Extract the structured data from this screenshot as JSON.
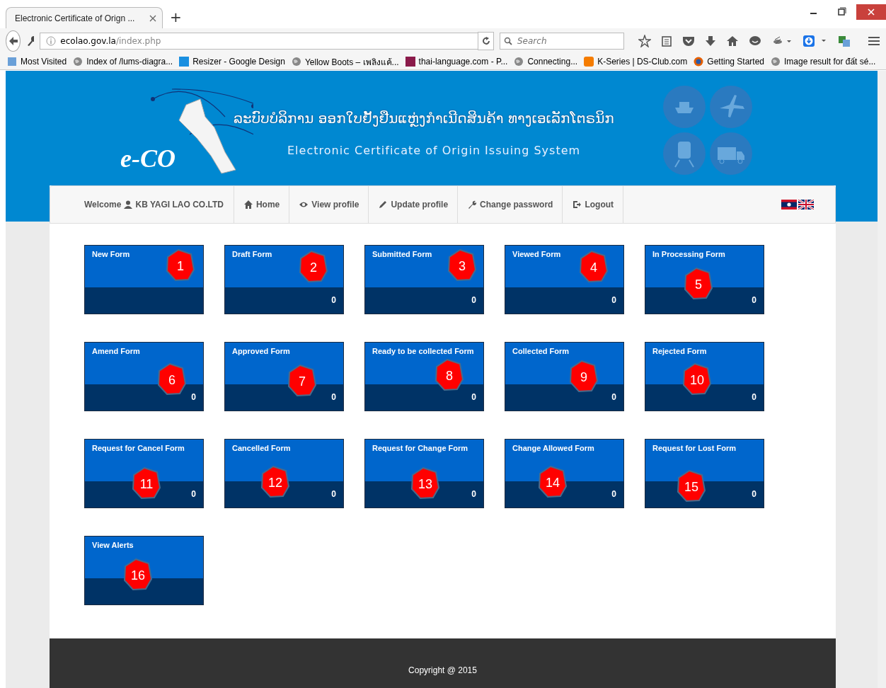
{
  "browser": {
    "tab_title": "Electronic Certificate of Orign ...",
    "new_tab": "+",
    "url_domain": "ecolao.gov.la",
    "url_path": "/index.php",
    "search_placeholder": "Search",
    "bookmarks": [
      "Most Visited",
      "Index of /lums-diagra...",
      "Resizer - Google Design",
      "Yellow Boots – เพลิงแค้...",
      "thai-language.com - P...",
      "Connecting...",
      "K-Series | DS-Club.com",
      "Getting Started",
      "Image result for đất sé..."
    ]
  },
  "header": {
    "logo": "e-CO",
    "title_lao": "ລະບົບບໍລິການ ອອກໃບຢັ້ງຢືນແຫຼ່ງກຳເນີດສິນຄ້າ ທາງເອເລັກໂຕຣນິກ",
    "title_en": "Electronic Certificate of Origin Issuing System"
  },
  "nav": {
    "welcome": "Welcome",
    "user": "KB YAGI LAO CO.LTD",
    "items": [
      {
        "label": "Home"
      },
      {
        "label": "View profile"
      },
      {
        "label": "Update profile"
      },
      {
        "label": "Change password"
      },
      {
        "label": "Logout"
      }
    ]
  },
  "tiles": [
    {
      "title": "New Form",
      "marker": "1"
    },
    {
      "title": "Draft Form",
      "count": "0",
      "marker": "2"
    },
    {
      "title": "Submitted Form",
      "count": "0",
      "marker": "3"
    },
    {
      "title": "Viewed Form",
      "count": "0",
      "marker": "4"
    },
    {
      "title": "In Processing Form",
      "count": "0",
      "marker": "5"
    },
    {
      "title": "Amend Form",
      "count": "0",
      "marker": "6"
    },
    {
      "title": "Approved Form",
      "count": "0",
      "marker": "7"
    },
    {
      "title": "Ready to be collected Form",
      "count": "0",
      "marker": "8"
    },
    {
      "title": "Collected Form",
      "count": "0",
      "marker": "9"
    },
    {
      "title": "Rejected Form",
      "count": "0",
      "marker": "10"
    },
    {
      "title": "Request for Cancel Form",
      "count": "0",
      "marker": "11"
    },
    {
      "title": "Cancelled Form",
      "count": "0",
      "marker": "12"
    },
    {
      "title": "Request for Change Form",
      "count": "0",
      "marker": "13"
    },
    {
      "title": "Change Allowed Form",
      "count": "0",
      "marker": "14"
    },
    {
      "title": "Request for Lost Form",
      "count": "0",
      "marker": "15"
    },
    {
      "title": "View Alerts",
      "marker": "16"
    }
  ],
  "footer": "Copyright @ 2015"
}
